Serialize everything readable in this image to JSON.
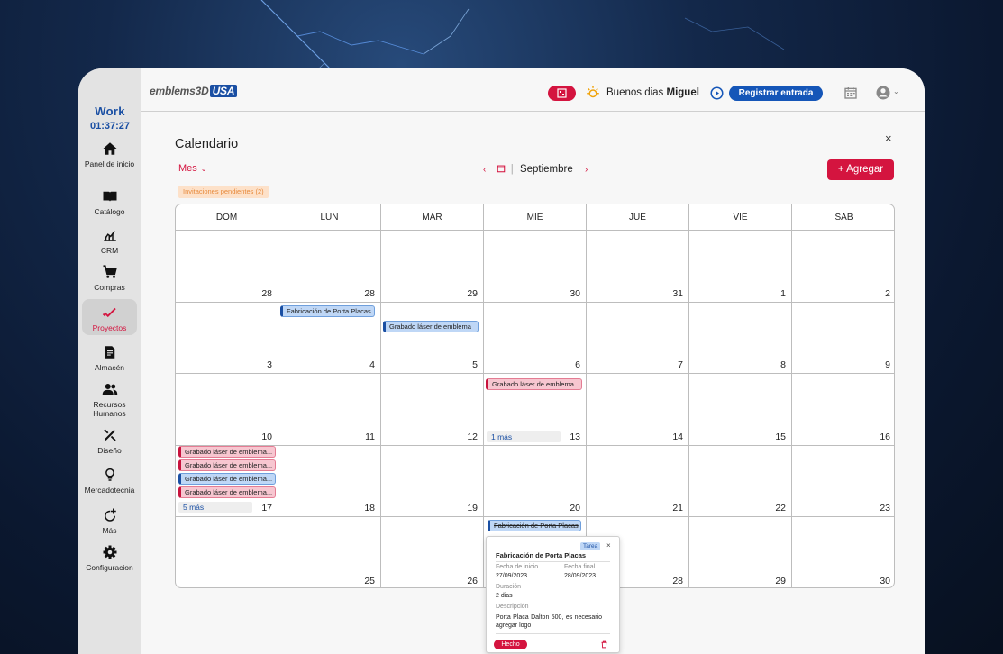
{
  "app": {
    "work_label": "Work",
    "timer": "01:37:27",
    "logo_main": "emblems3D",
    "logo_badge": "USA",
    "greeting_prefix": "Buenos dias",
    "user_name": "Miguel",
    "register_button": "Registrar entrada"
  },
  "sidebar": {
    "items": [
      {
        "label": "Panel de inicio",
        "icon": "home-icon"
      },
      {
        "label": "Catálogo",
        "icon": "book-icon"
      },
      {
        "label": "CRM",
        "icon": "chart-icon"
      },
      {
        "label": "Compras",
        "icon": "cart-icon"
      },
      {
        "label": "Proyectos",
        "icon": "check-icon"
      },
      {
        "label": "Almacén",
        "icon": "inventory-icon"
      },
      {
        "label": "Recursos Humanos",
        "icon": "people-icon"
      },
      {
        "label": "Diseño",
        "icon": "design-tools-icon"
      },
      {
        "label": "Mercadotecnia",
        "icon": "lightbulb-icon"
      },
      {
        "label": "Más",
        "icon": "refresh-plus-icon"
      },
      {
        "label": "Configuracion",
        "icon": "gear-icon"
      }
    ]
  },
  "page": {
    "title": "Calendario",
    "view_mode": "Mes",
    "pending_invites": "Invitaciones pendientes (2)",
    "month": "Septiembre",
    "add_button": "+ Agregar",
    "close": "×"
  },
  "calendar": {
    "weekdays": [
      "DOM",
      "LUN",
      "MAR",
      "MIE",
      "JUE",
      "VIE",
      "SAB"
    ],
    "weeks": [
      [
        "28",
        "28",
        "29",
        "30",
        "31",
        "1",
        "2"
      ],
      [
        "3",
        "4",
        "5",
        "6",
        "7",
        "8",
        "9"
      ],
      [
        "10",
        "11",
        "12",
        "13",
        "14",
        "15",
        "16"
      ],
      [
        "",
        "18",
        "19",
        "20",
        "21",
        "22",
        "23"
      ],
      [
        "",
        "25",
        "26",
        "",
        "28",
        "29",
        "30"
      ]
    ],
    "week4_sunday": "17",
    "events": {
      "e1": "Fabricación de Porta Placas",
      "e2": "Grabado láser de emblema",
      "e3": "Grabado láser de emblema",
      "e4": "Grabado láser de emblema...",
      "e5": "Grabado láser de emblema...",
      "e6": "Grabado láser de emblema...",
      "e7": "Grabado láser de emblema...",
      "e8": "Fabricación de Porta Placas"
    },
    "more_13": "1 más",
    "more_17": "5 más"
  },
  "popup": {
    "title": "Fabricación de Porta Placas",
    "tag": "Tarea",
    "close": "×",
    "start_label": "Fecha de inicio",
    "start_value": "27/09/2023",
    "end_label": "Fecha final",
    "end_value": "28/09/2023",
    "duration_label": "Duración",
    "duration_value": "2 dias",
    "description_label": "Descripción",
    "description_value": "Porta Placa Dalton 500, es necesario agregar logo",
    "done_button": "Hecho"
  },
  "colors": {
    "accent": "#d4143f",
    "primary": "#1556b8",
    "event_blue": "#bfd7f6",
    "event_pink": "#f7c6d0"
  }
}
